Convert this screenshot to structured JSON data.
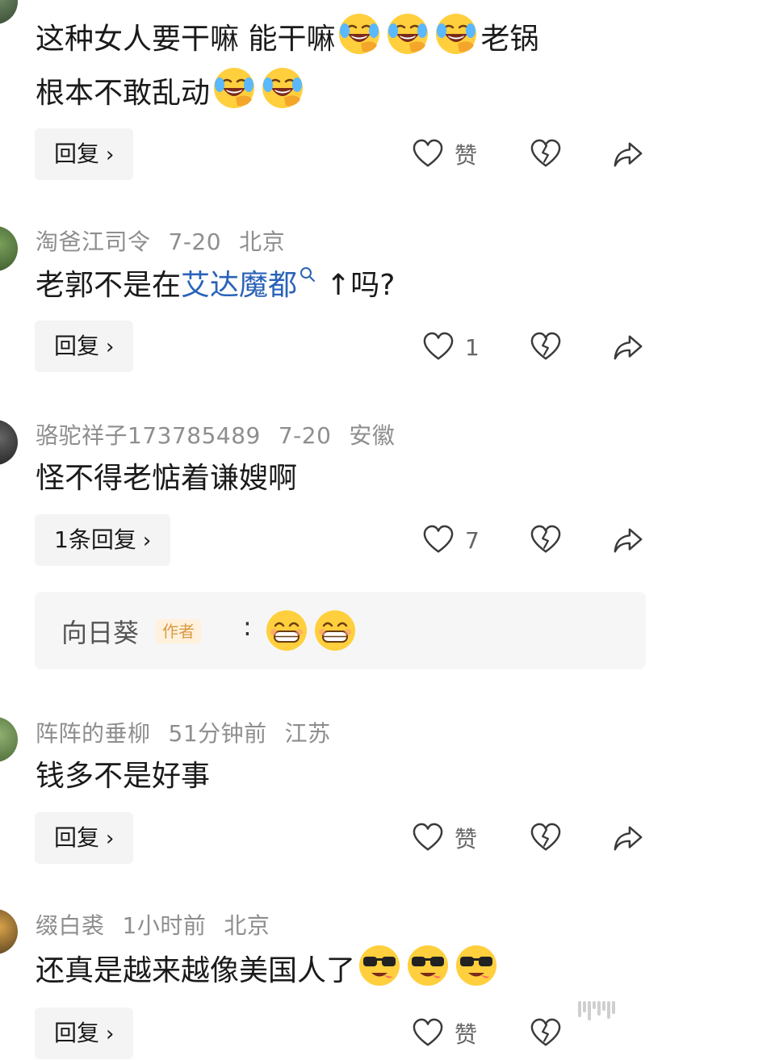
{
  "comments": [
    {
      "text_line1": "这种女人要干嘛 能干嘛",
      "text_line1_end": "老锅",
      "text_line2": "根本不敢乱动",
      "reply_label": "回复",
      "like_label": "赞"
    },
    {
      "user": "淘爸江司令",
      "date": "7-20",
      "location": "北京",
      "text_before": "老郭不是在",
      "link": "艾达魔都",
      "text_after": "↑吗?",
      "reply_label": "回复",
      "like_count": "1"
    },
    {
      "user": "骆驼祥子173785489",
      "date": "7-20",
      "location": "安徽",
      "text": "怪不得老惦着谦嫂啊",
      "reply_label": "1条回复",
      "like_count": "7",
      "subreply": {
        "name": "向日葵",
        "badge": "作者",
        "colon": ":"
      }
    },
    {
      "user": "阵阵的垂柳",
      "date": "51分钟前",
      "location": "江苏",
      "text": "钱多不是好事",
      "reply_label": "回复",
      "like_label": "赞"
    },
    {
      "user": "缀白裘",
      "date": "1小时前",
      "location": "北京",
      "text": "还真是越来越像美国人了",
      "reply_label": "回复",
      "like_label": "赞"
    }
  ],
  "icons": {
    "like": "heart-outline-icon",
    "dislike": "broken-heart-icon",
    "share": "share-arrow-icon",
    "emoji_laugh": "laughing-crying-emoji",
    "emoji_grin": "grinning-emoji",
    "emoji_cool": "sunglasses-emoji"
  },
  "colors": {
    "link": "#2a63b8",
    "badge": "#d89a45",
    "meta": "#8e8e8e"
  }
}
